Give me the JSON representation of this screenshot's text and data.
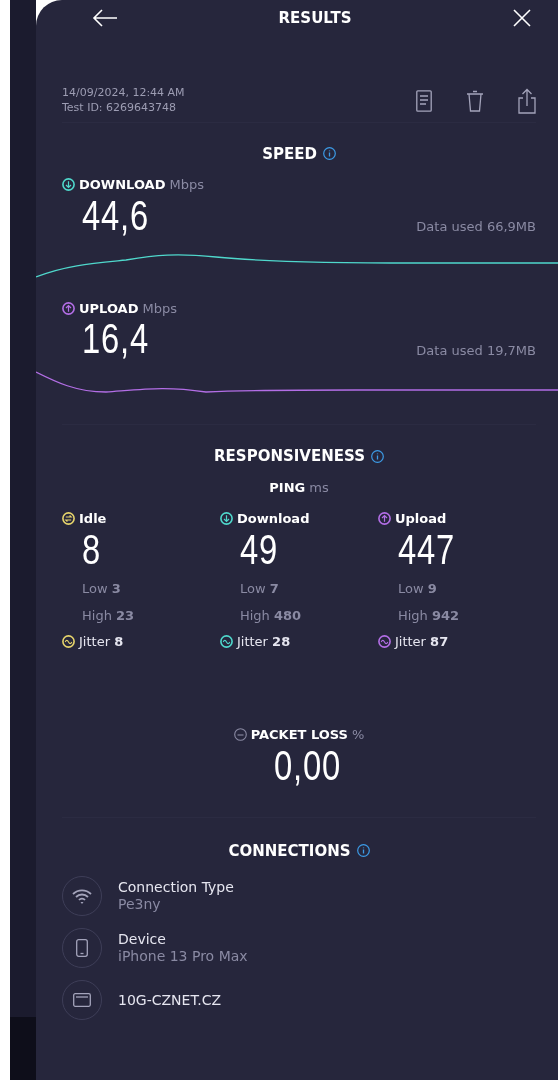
{
  "header": {
    "title": "RESULTS"
  },
  "meta": {
    "date": "14/09/2024, 12:44 AM",
    "test_id": "Test ID: 6269643748"
  },
  "speed": {
    "title": "SPEED",
    "metrics": [
      {
        "kind": "download",
        "label": "DOWNLOAD",
        "unit": "Mbps",
        "value": "44,6",
        "data_used": "Data used 66,9MB",
        "color": "#4fd8cc"
      },
      {
        "kind": "upload",
        "label": "UPLOAD",
        "unit": "Mbps",
        "value": "16,4",
        "data_used": "Data used 19,7MB",
        "color": "#b36ee6"
      }
    ]
  },
  "responsiveness": {
    "title": "RESPONSIVENESS",
    "ping_label": "PING",
    "ping_unit": "ms",
    "columns": [
      {
        "kind": "idle",
        "label": "Idle",
        "value": "8",
        "low_label": "Low",
        "low": "3",
        "high_label": "High",
        "high": "23",
        "jitter_label": "Jitter",
        "jitter": "8",
        "color": "#e6d46c"
      },
      {
        "kind": "download",
        "label": "Download",
        "value": "49",
        "low_label": "Low",
        "low": "7",
        "high_label": "High",
        "high": "480",
        "jitter_label": "Jitter",
        "jitter": "28",
        "color": "#4fd8cc"
      },
      {
        "kind": "upload",
        "label": "Upload",
        "value": "447",
        "low_label": "Low",
        "low": "9",
        "high_label": "High",
        "high": "942",
        "jitter_label": "Jitter",
        "jitter": "87",
        "color": "#b36ee6"
      }
    ]
  },
  "packet_loss": {
    "label": "PACKET LOSS",
    "unit": "%",
    "value": "0,00"
  },
  "connections": {
    "title": "CONNECTIONS",
    "items": [
      {
        "kind": "wifi",
        "label": "Connection Type",
        "value": "Pe3ny"
      },
      {
        "kind": "device",
        "label": "Device",
        "value": "iPhone 13 Pro Max"
      },
      {
        "kind": "server",
        "label": "10G-CZNET.CZ"
      }
    ]
  }
}
